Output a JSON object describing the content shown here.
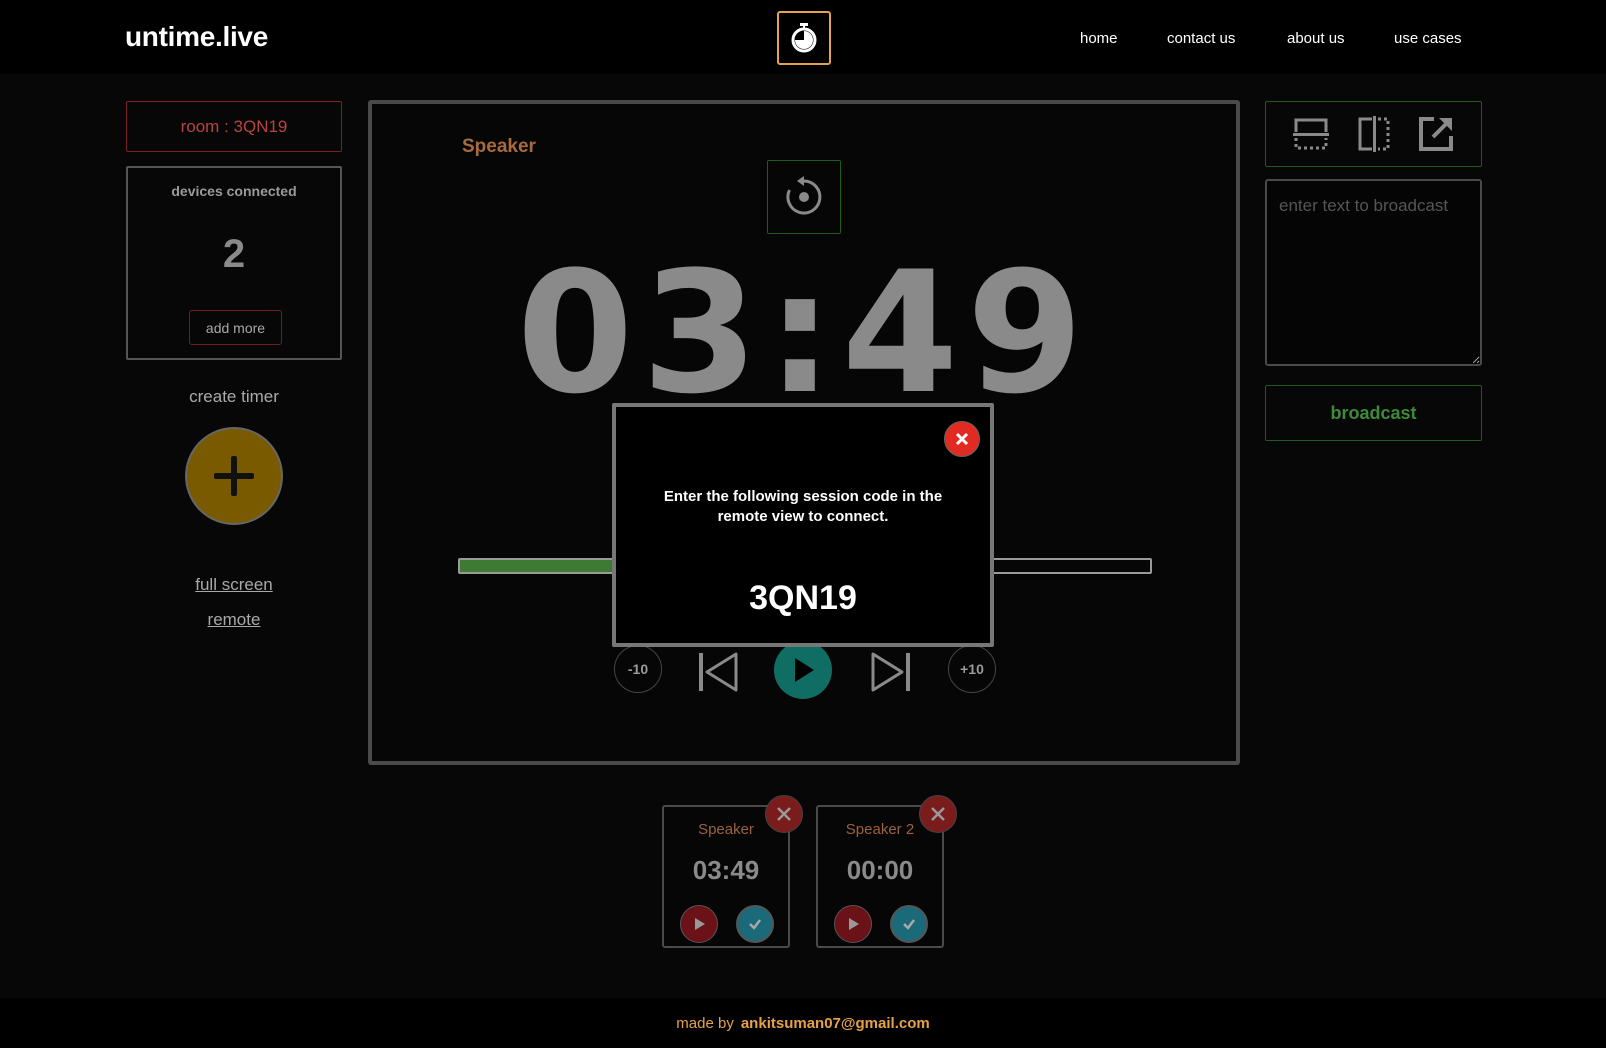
{
  "header": {
    "brand": "untime.live",
    "nav": [
      "home",
      "contact us",
      "about us",
      "use cases"
    ]
  },
  "sidebar": {
    "room_label": "room : 3QN19",
    "devices_label": "devices connected",
    "devices_count": "2",
    "add_more_label": "add more",
    "create_timer_label": "create timer",
    "full_screen_label": "full screen",
    "remote_label": "remote"
  },
  "stage": {
    "speaker_name": "Speaker",
    "timer_display": "03:49",
    "progress_fraction": 0.22,
    "minus_label": "-10",
    "plus_label": "+10"
  },
  "right_panel": {
    "broadcast_placeholder": "enter text to broadcast",
    "broadcast_button": "broadcast"
  },
  "timers": [
    {
      "name": "Speaker",
      "time": "03:49"
    },
    {
      "name": "Speaker 2",
      "time": "00:00"
    }
  ],
  "modal": {
    "message": "Enter the following session code in the remote view to connect.",
    "code": "3QN19"
  },
  "footer": {
    "made_by": "made by",
    "email": "ankitsuman07@gmail.com"
  },
  "colors": {
    "accent_orange": "#e6a24a",
    "progress_green": "#3f7a34",
    "play_teal": "#0f6d63",
    "close_red": "#e02a22"
  }
}
